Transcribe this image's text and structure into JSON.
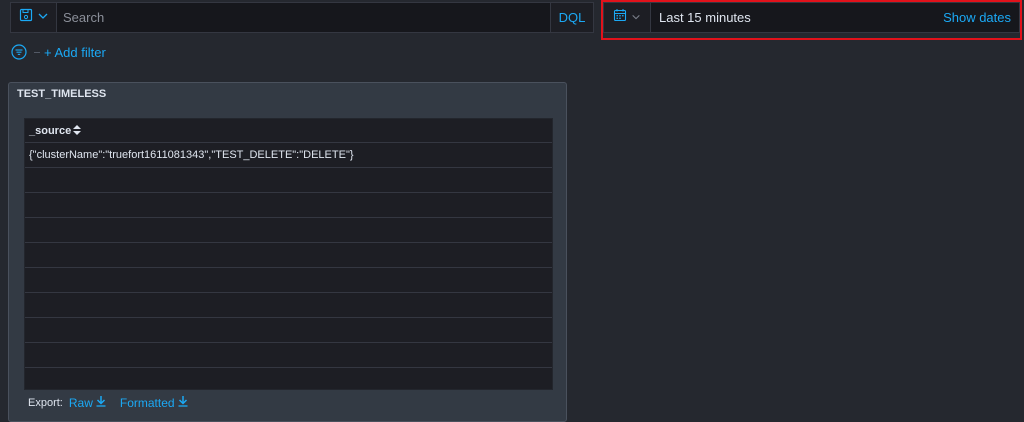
{
  "query_bar": {
    "search_placeholder": "Search",
    "search_value": "",
    "language_label": "DQL"
  },
  "time_picker": {
    "range_label": "Last 15 minutes",
    "show_dates_label": "Show dates"
  },
  "filters": {
    "add_filter_label": "+ Add filter"
  },
  "panel": {
    "title": "TEST_TIMELESS",
    "table": {
      "column_header": "_source",
      "rows": [
        "{\"clusterName\":\"truefort1611081343\",\"TEST_DELETE\":\"DELETE\"}",
        "",
        "",
        "",
        "",
        "",
        "",
        "",
        "",
        ""
      ]
    },
    "export": {
      "label": "Export:",
      "raw_label": "Raw",
      "formatted_label": "Formatted"
    }
  },
  "colors": {
    "accent": "#1ba9f5",
    "highlight": "#e1121b",
    "background": "#25282f"
  }
}
